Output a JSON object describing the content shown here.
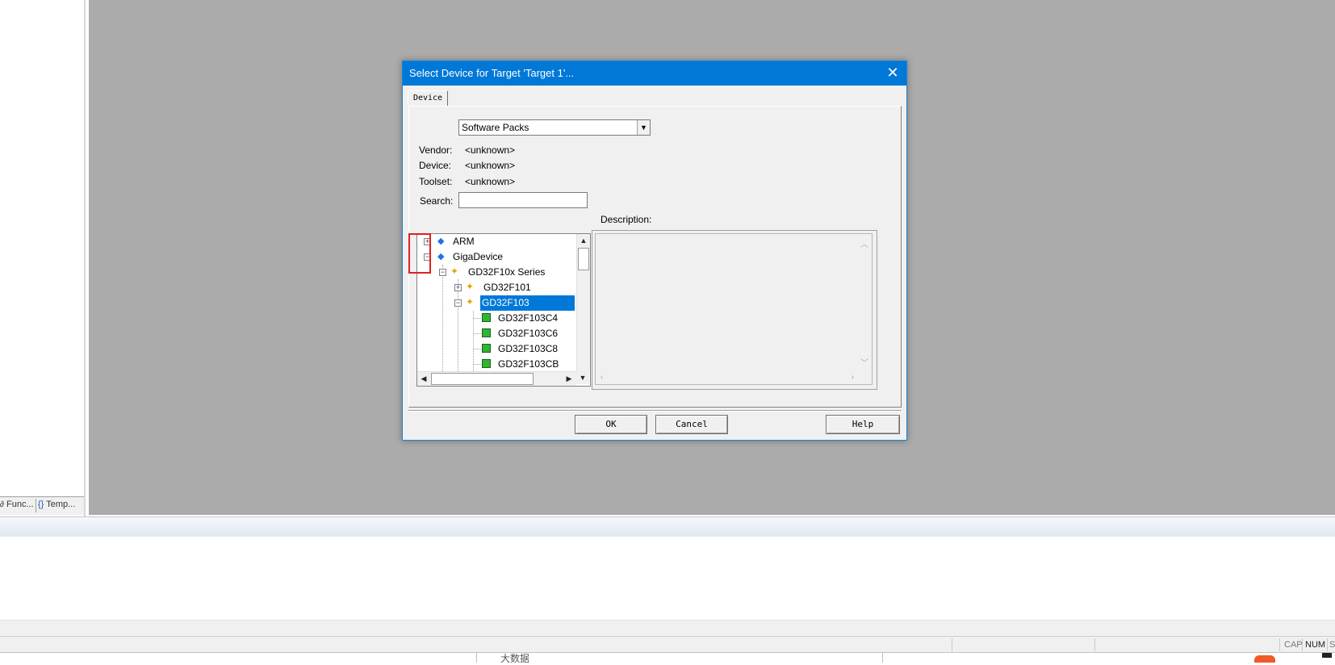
{
  "left_panel": {
    "tabs": [
      {
        "icon": "functions-icon",
        "label": "Func..."
      },
      {
        "icon": "templates-icon",
        "label": "Temp..."
      }
    ]
  },
  "status_bar": {
    "cap": "CAP",
    "num": "NUM",
    "scrl": "S"
  },
  "taskbar": {
    "text": "大数据"
  },
  "dialog": {
    "title": "Select Device for Target 'Target 1'...",
    "tab_label": "Device",
    "pack_select": {
      "value": "Software Packs"
    },
    "vendor_label": "Vendor:",
    "vendor_value": "<unknown>",
    "device_label": "Device:",
    "device_value": "<unknown>",
    "toolset_label": "Toolset:",
    "toolset_value": "<unknown>",
    "search_label": "Search:",
    "search_value": "",
    "description_label": "Description:",
    "tree": [
      {
        "label": "ARM",
        "level": 0,
        "expander": "plus",
        "icon": "vendor-diamond-icon"
      },
      {
        "label": "GigaDevice",
        "level": 0,
        "expander": "minus",
        "icon": "vendor-diamond-icon"
      },
      {
        "label": "GD32F10x Series",
        "level": 1,
        "expander": "minus",
        "icon": "device-family-icon"
      },
      {
        "label": "GD32F101",
        "level": 2,
        "expander": "plus",
        "icon": "device-subfamily-icon"
      },
      {
        "label": "GD32F103",
        "level": 2,
        "expander": "minus",
        "icon": "device-subfamily-icon",
        "selected": true
      },
      {
        "label": "GD32F103C4",
        "level": 3,
        "expander": "none",
        "icon": "chip-icon"
      },
      {
        "label": "GD32F103C6",
        "level": 3,
        "expander": "none",
        "icon": "chip-icon"
      },
      {
        "label": "GD32F103C8",
        "level": 3,
        "expander": "none",
        "icon": "chip-icon"
      },
      {
        "label": "GD32F103CB",
        "level": 3,
        "expander": "none",
        "icon": "chip-icon"
      }
    ],
    "buttons": {
      "ok": "OK",
      "cancel": "Cancel",
      "help": "Help"
    }
  },
  "colors": {
    "titlebar": "#0078d7",
    "selection": "#0078d7",
    "workspace": "#ababab",
    "highlight_box": "#e02020"
  }
}
